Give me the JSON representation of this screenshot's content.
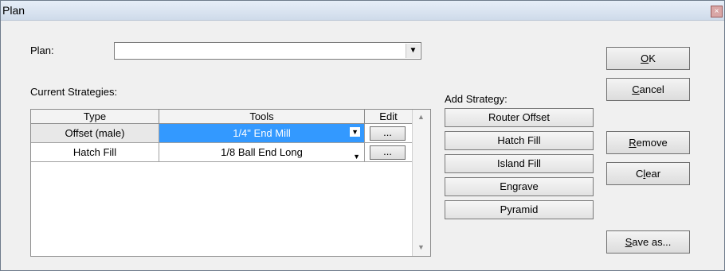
{
  "window": {
    "title": "Plan",
    "close_glyph": "×"
  },
  "plan": {
    "label": "Plan:",
    "value": ""
  },
  "current_strategies": {
    "label": "Current Strategies:",
    "columns": [
      "Type",
      "Tools",
      "Edit"
    ],
    "rows": [
      {
        "type": "Offset (male)",
        "tool": "1/4\" End Mill",
        "edit": "..."
      },
      {
        "type": "Hatch Fill",
        "tool": "1/8 Ball End Long",
        "edit": "..."
      }
    ]
  },
  "add_strategy": {
    "label": "Add Strategy:",
    "items": [
      "Router Offset",
      "Hatch Fill",
      "Island Fill",
      "Engrave",
      "Pyramid"
    ]
  },
  "buttons": {
    "ok": {
      "hot": "O",
      "rest": "K"
    },
    "cancel": {
      "hot": "C",
      "rest": "ancel"
    },
    "remove": {
      "hot": "R",
      "rest": "emove"
    },
    "clear": {
      "pre": "C",
      "hot": "l",
      "rest": "ear"
    },
    "save_as": {
      "hot": "S",
      "rest": "ave as..."
    }
  },
  "colors": {
    "selected_cell": "#3399ff",
    "titlebar": "#d6e2f0"
  }
}
